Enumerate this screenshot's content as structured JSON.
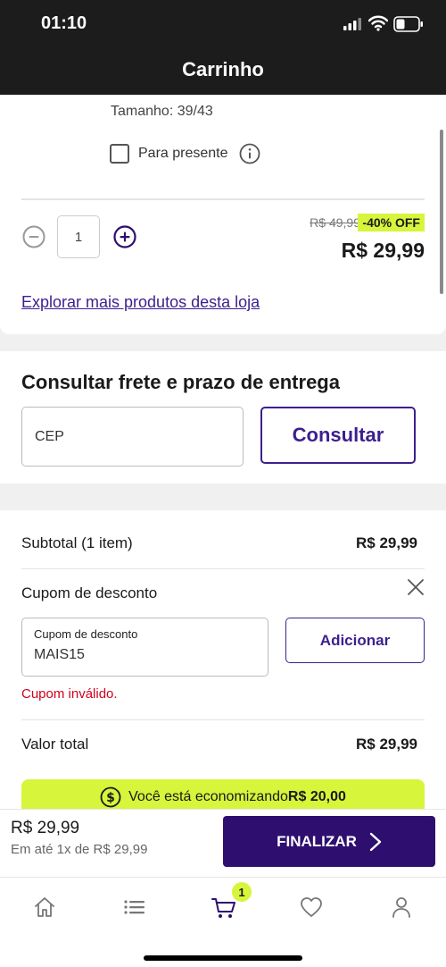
{
  "status_bar": {
    "time": "01:10"
  },
  "header": {
    "title": "Carrinho"
  },
  "product": {
    "size_text": "Tamanho: 39/43",
    "gift_label": "Para presente",
    "quantity": "1",
    "old_price": "R$ 49,99",
    "discount": "-40% OFF",
    "price": "R$ 29,99",
    "explore_link": "Explorar mais produtos desta loja"
  },
  "shipping": {
    "title": "Consultar frete e prazo de entrega",
    "cep_placeholder": "CEP",
    "button": "Consultar"
  },
  "summary": {
    "subtotal_label": "Subtotal (1 item)",
    "subtotal_value": "R$ 29,99",
    "coupon_title": "Cupom de desconto",
    "coupon_field_label": "Cupom de desconto",
    "coupon_value": "MAIS15",
    "add_button": "Adicionar",
    "error": "Cupom inválido.",
    "total_label": "Valor total",
    "total_value": "R$ 29,99",
    "savings_prefix": "Você está economizando ",
    "savings_amount": "R$ 20,00"
  },
  "checkout_bar": {
    "price": "R$ 29,99",
    "installments": "Em até 1x de R$ 29,99",
    "button": "FINALIZAR"
  },
  "tab_bar": {
    "cart_badge": "1"
  },
  "colors": {
    "brand": "#2e0f6f",
    "accent": "#d6f53b",
    "error": "#d0021b"
  }
}
